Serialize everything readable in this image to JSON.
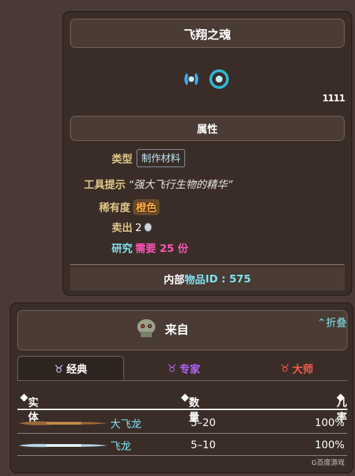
{
  "item": {
    "name": "飞翔之魂",
    "stack": "1111",
    "section_title": "属性",
    "type_label": "类型",
    "type_value": "制作材料",
    "tooltip_label": "工具提示",
    "tooltip_value": "“强大飞行生物的精华”",
    "rarity_label": "稀有度",
    "rarity_value": "橙色",
    "sell_label": "卖出",
    "sell_value": "2",
    "research_label": "研究",
    "research_value": "需要 25 份",
    "id_prefix": "内部",
    "id_mid": "物品",
    "id_suffix": " ID : 575"
  },
  "drops": {
    "title": "来自",
    "collapse_label": "折叠",
    "tabs": [
      "经典",
      "专家",
      "大师"
    ],
    "headers": [
      "实体",
      "数量",
      "几率"
    ],
    "rows": [
      {
        "entity": "大飞龙",
        "quantity": "5–20",
        "chance": "100%"
      },
      {
        "entity": "飞龙",
        "quantity": "5–10",
        "chance": "100%"
      }
    ],
    "watermark": "G百度游戏"
  },
  "colors": {
    "classic_tab": "#ffffff",
    "expert_tab": "#b266ff",
    "master_tab": "#ff5a4a",
    "accent": "#7ee3ef"
  }
}
